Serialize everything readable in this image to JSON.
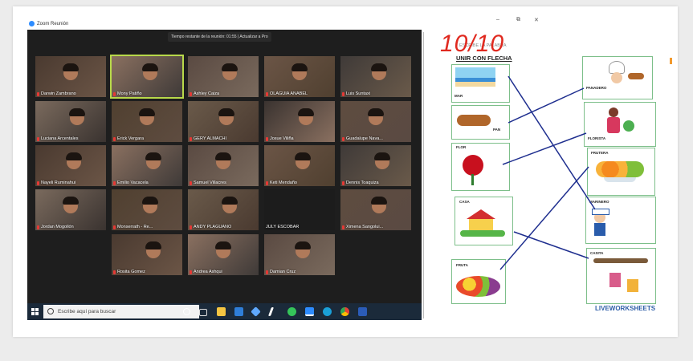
{
  "zoom": {
    "window_title": "Zoom Reunión",
    "timer": "Tiempo restante de la reunión: 01:55 | Actualizar a Pro",
    "participants": [
      "Darwin Zambrano",
      "Mony Patiño",
      "Ashley Caiza",
      "OLAGUIA ANABEL",
      "Luis Suntaxi",
      "Luciana Arcentales",
      "Erick Vergara",
      "GERY ALMACHI",
      "Josue Viliña",
      "Guadalupe Nava...",
      "Nayeli Ruminahui",
      "Emilio Vacacela",
      "Samuel Villacres",
      "Keti Mendaño",
      "Dennis Toaquiza",
      "Jordan Mogollón",
      "Monserrath - Re...",
      "ANDY PLAGUANO",
      "JULY ESCOBAR",
      "Ximena Sangolui...",
      "Rosita Gomez",
      "Andrea Ashqui",
      "Damian Cruz"
    ]
  },
  "taskbar": {
    "search_placeholder": "Escribe aquí para buscar",
    "icons": [
      "windows-icon",
      "cortana-icon",
      "task-view-icon",
      "file-explorer-icon",
      "mail-icon",
      "dropbox-icon",
      "bolt-icon",
      "whatsapp-icon",
      "zoom-icon",
      "edge-icon",
      "chrome-icon",
      "word-icon"
    ]
  },
  "worksheet": {
    "score": "10/10",
    "header": "ESCRIBE LA PALABRA",
    "title": "UNIR CON FLECHA",
    "left_items": [
      "MAR",
      "PAN",
      "FLOR",
      "CASA",
      "FRUTA"
    ],
    "right_items": [
      "PANADERO",
      "FLORISTA",
      "FRUTERA",
      "MARINERO",
      "CASITA"
    ],
    "brand": "LIVEWORKSHEETS",
    "window_controls": [
      "–",
      "⧉",
      "✕"
    ]
  },
  "colors": {
    "zoom_bg": "#1e1e1e",
    "active_speaker": "#b8d94a",
    "score": "#e0291f",
    "card_border": "#7dbf8a",
    "match_line": "#1f2f8f"
  }
}
